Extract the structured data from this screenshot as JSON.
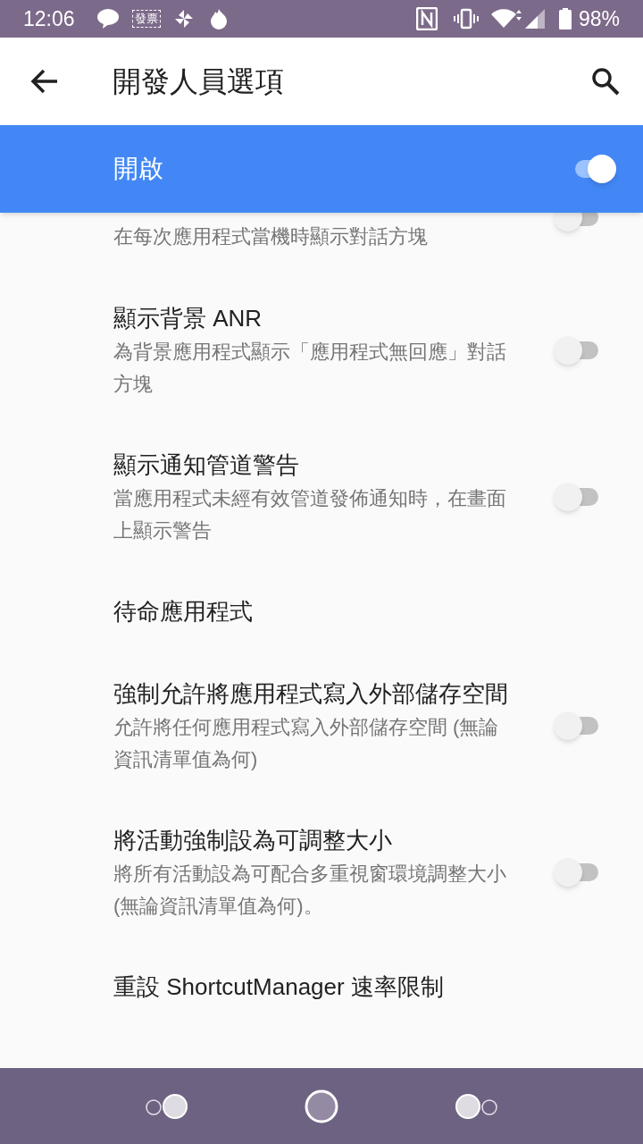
{
  "status_bar": {
    "time": "12:06",
    "notification_badge": "發票",
    "battery": "98%"
  },
  "app_bar": {
    "title": "開發人員選項"
  },
  "master_switch": {
    "label": "開啟",
    "on": true
  },
  "settings": [
    {
      "kind": "switch",
      "subtitle": "在每次應用程式當機時顯示對話方塊",
      "on": false
    },
    {
      "kind": "switch",
      "title": "顯示背景 ANR",
      "subtitle": "為背景應用程式顯示「應用程式無回應」對話方塊",
      "on": false
    },
    {
      "kind": "switch",
      "title": "顯示通知管道警告",
      "subtitle": "當應用程式未經有效管道發佈通知時，在畫面上顯示警告",
      "on": false
    },
    {
      "kind": "link",
      "title": "待命應用程式"
    },
    {
      "kind": "switch",
      "title": "強制允許將應用程式寫入外部儲存空間",
      "subtitle": "允許將任何應用程式寫入外部儲存空間 (無論資訊清單值為何)",
      "on": false
    },
    {
      "kind": "switch",
      "title": "將活動強制設為可調整大小",
      "subtitle": "將所有活動設為可配合多重視窗環境調整大小 (無論資訊清單值為何)。",
      "on": false
    },
    {
      "kind": "link",
      "title": "重設 ShortcutManager 速率限制"
    }
  ]
}
